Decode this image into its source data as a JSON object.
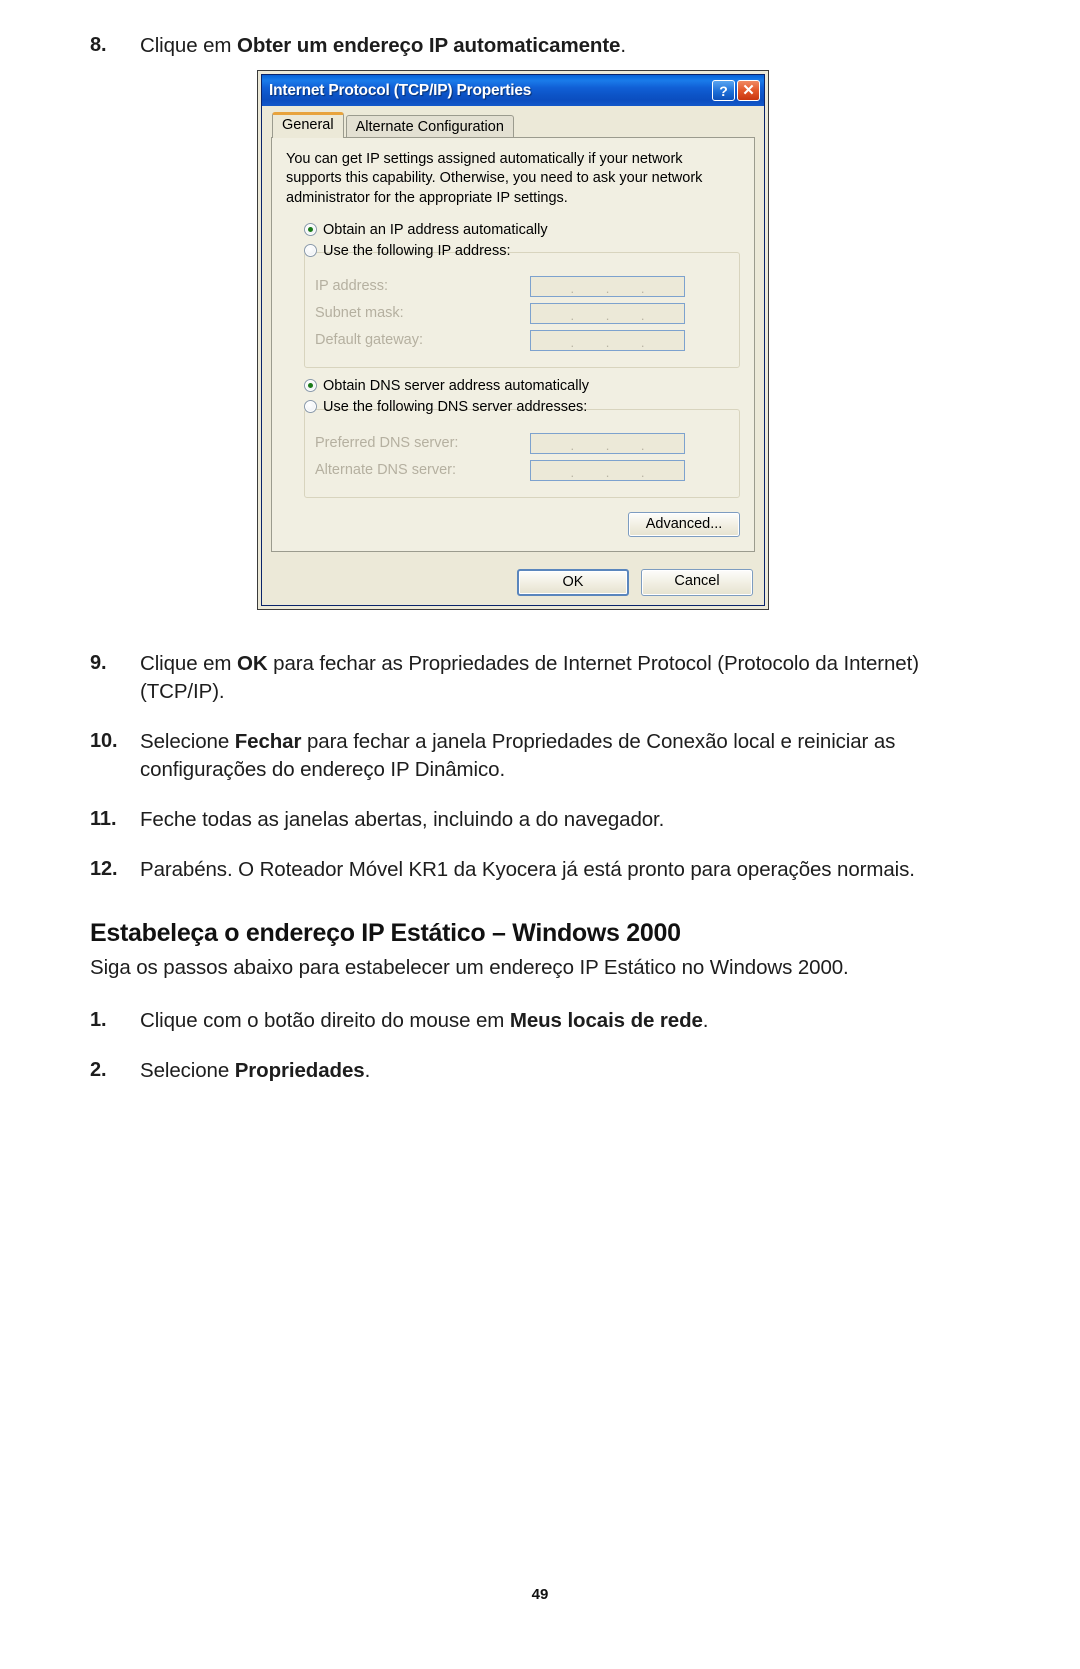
{
  "steps_top": [
    {
      "num": "8.",
      "parts": [
        {
          "t": "Clique em ",
          "b": false
        },
        {
          "t": "Obter um endereço IP automaticamente",
          "b": true
        },
        {
          "t": ".",
          "b": false
        }
      ]
    }
  ],
  "dialog": {
    "title": "Internet Protocol (TCP/IP) Properties",
    "help_button": "?",
    "close_button": "✕",
    "tabs": [
      {
        "label": "General",
        "active": true
      },
      {
        "label": "Alternate Configuration",
        "active": false
      }
    ],
    "description": "You can get IP settings assigned automatically if your network supports this capability. Otherwise, you need to ask your network administrator for the appropriate IP settings.",
    "ip_radio_auto": "Obtain an IP address automatically",
    "ip_radio_manual": "Use the following IP address:",
    "ip_fields": [
      {
        "label": "IP address:",
        "value": ""
      },
      {
        "label": "Subnet mask:",
        "value": ""
      },
      {
        "label": "Default gateway:",
        "value": ""
      }
    ],
    "dns_radio_auto": "Obtain DNS server address automatically",
    "dns_radio_manual": "Use the following DNS server addresses:",
    "dns_fields": [
      {
        "label": "Preferred DNS server:",
        "value": ""
      },
      {
        "label": "Alternate DNS server:",
        "value": ""
      }
    ],
    "advanced_button": "Advanced...",
    "ok_button": "OK",
    "cancel_button": "Cancel"
  },
  "steps_bottom": [
    {
      "num": "9.",
      "parts": [
        {
          "t": "Clique em ",
          "b": false
        },
        {
          "t": "OK",
          "b": true
        },
        {
          "t": " para fechar as Propriedades de Internet Protocol (Protocolo da Internet) (TCP/IP).",
          "b": false
        }
      ]
    },
    {
      "num": "10.",
      "parts": [
        {
          "t": "Selecione ",
          "b": false
        },
        {
          "t": "Fechar",
          "b": true
        },
        {
          "t": " para fechar a janela Propriedades de Conexão local e reiniciar as configurações do endereço IP Dinâmico.",
          "b": false
        }
      ]
    },
    {
      "num": "11.",
      "parts": [
        {
          "t": "Feche todas as janelas abertas, incluindo a do navegador.",
          "b": false
        }
      ]
    },
    {
      "num": "12.",
      "parts": [
        {
          "t": "Parabéns. O Roteador Móvel KR1 da Kyocera já está pronto para operações normais.",
          "b": false
        }
      ]
    }
  ],
  "section": {
    "heading": "Estabeleça o endereço IP Estático – Windows 2000",
    "lead": "Siga os passos abaixo para estabelecer um endereço IP Estático no Windows 2000."
  },
  "steps_section": [
    {
      "num": "1.",
      "parts": [
        {
          "t": "Clique com o botão direito do mouse em ",
          "b": false
        },
        {
          "t": "Meus locais de rede",
          "b": true
        },
        {
          "t": ".",
          "b": false
        }
      ]
    },
    {
      "num": "2.",
      "parts": [
        {
          "t": "Selecione ",
          "b": false
        },
        {
          "t": "Propriedades",
          "b": true
        },
        {
          "t": ".",
          "b": false
        }
      ]
    }
  ],
  "page_number": "49"
}
